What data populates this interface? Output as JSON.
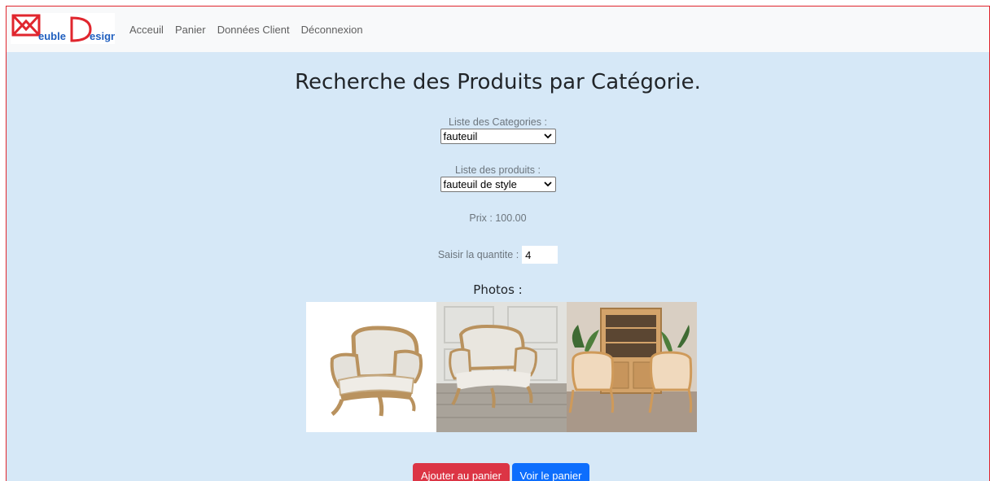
{
  "nav": {
    "links": [
      "Acceuil",
      "Panier",
      "Données Client",
      "Déconnexion"
    ]
  },
  "logo": {
    "text_main": "euble",
    "text_second": "esign",
    "color_red": "#e0262e",
    "color_blue": "#1f5fbf"
  },
  "page": {
    "title": "Recherche des Produits par Catégorie."
  },
  "form": {
    "categories_label": "Liste des Categories :",
    "category_selected": "fauteuil",
    "products_label": "Liste des produits :",
    "product_selected": "fauteuil de style",
    "price_text": "Prix : 100.00",
    "quantity_label": "Saisir la quantite :",
    "quantity_value": "4"
  },
  "photos": {
    "title": "Photos :",
    "items": [
      "armchair-white-background",
      "armchair-room-wood-floor",
      "two-armchairs-with-cabinet"
    ]
  },
  "buttons": {
    "add_to_cart": "Ajouter au panier",
    "view_cart": "Voir le panier"
  },
  "colors": {
    "background": "#d6e8f7",
    "navbar": "#f8f9fa",
    "button_red": "#dc3545",
    "button_blue": "#0d6efd"
  }
}
